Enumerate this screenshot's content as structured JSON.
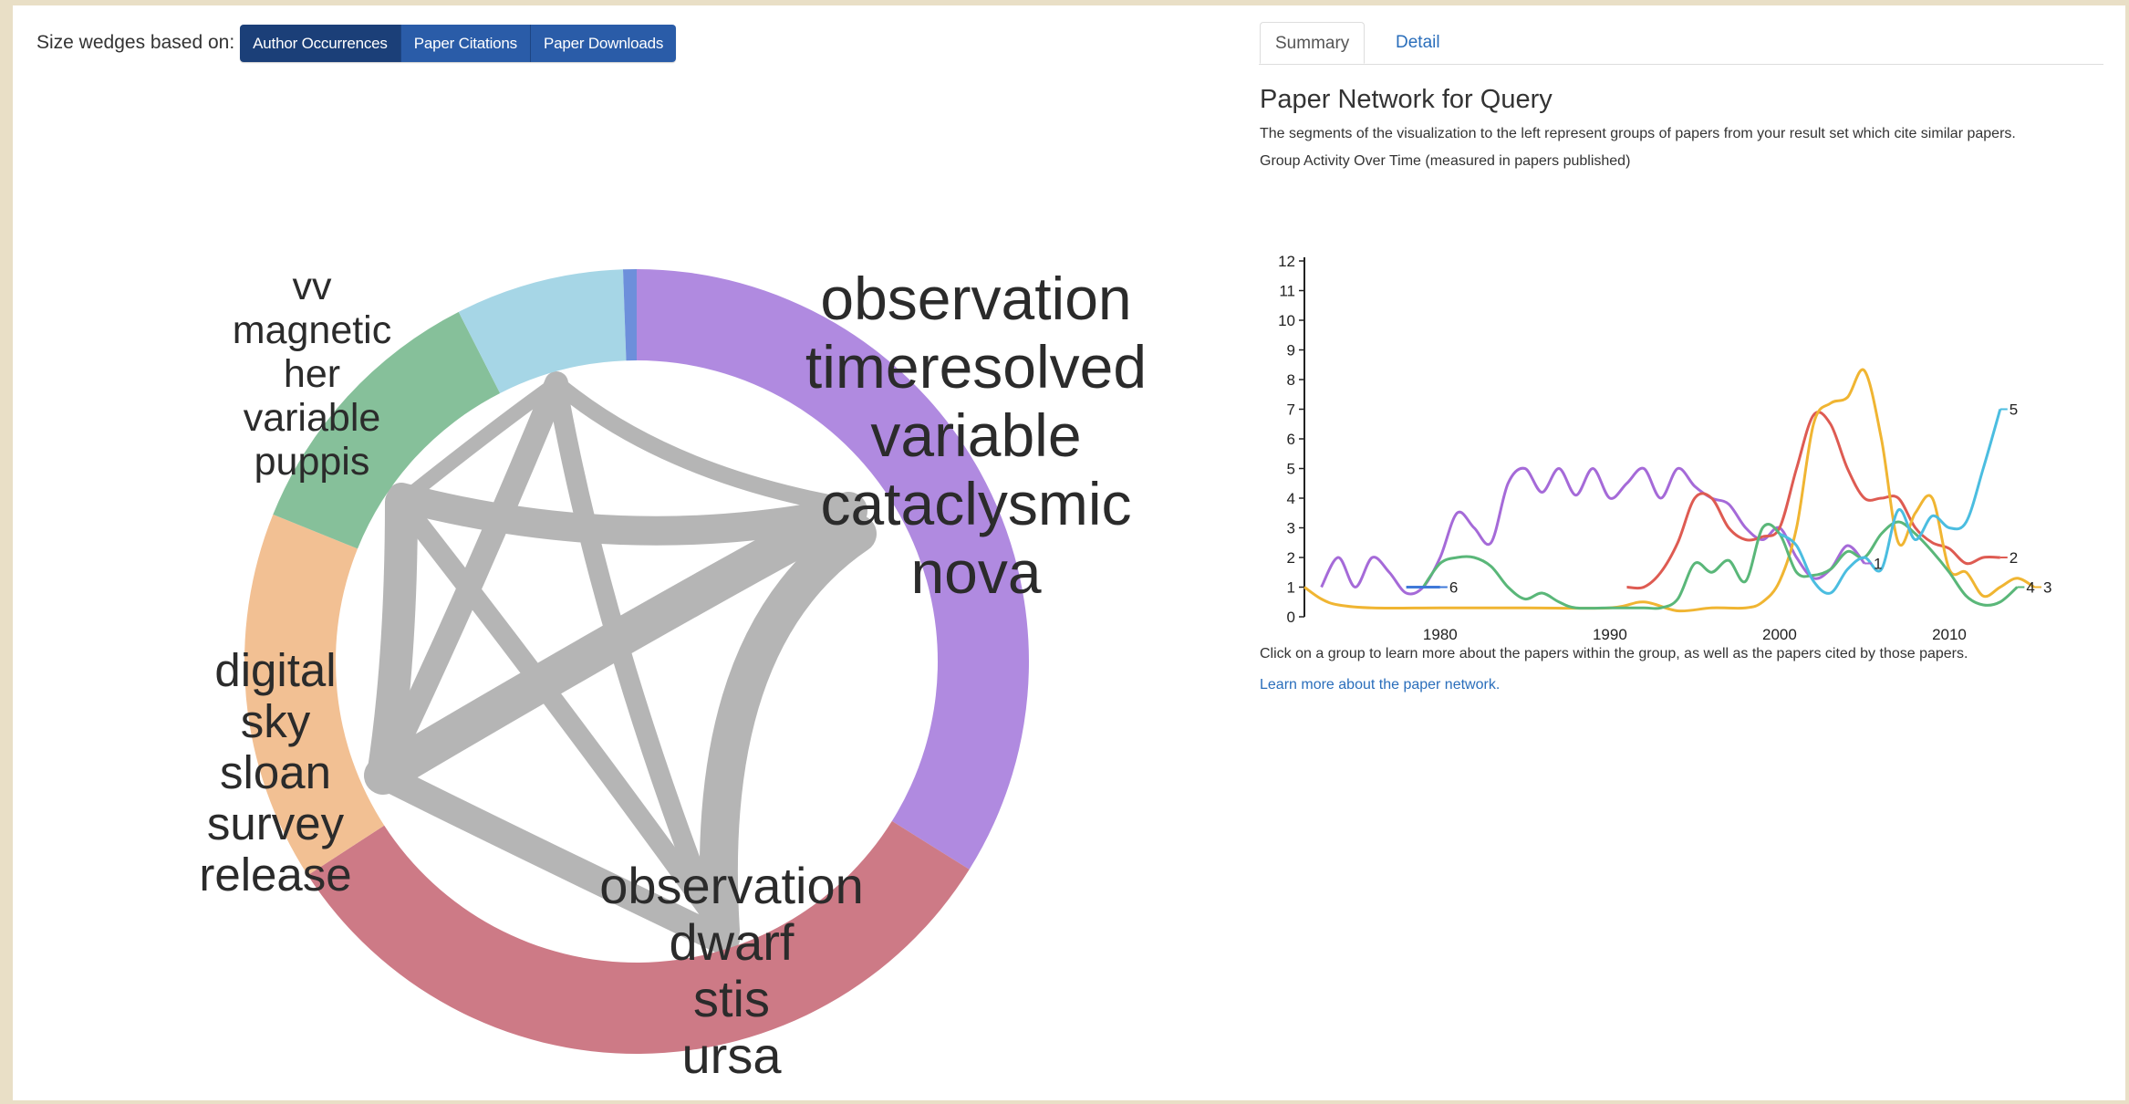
{
  "toolbar": {
    "label": "Size wedges based on:",
    "buttons": [
      "Author Occurrences",
      "Paper Citations",
      "Paper Downloads"
    ]
  },
  "wheel": {
    "groups": [
      {
        "name": "purple",
        "color": "#b08ae0",
        "lines": [
          "observation",
          "timeresolved",
          "variable",
          "cataclysmic",
          "nova"
        ]
      },
      {
        "name": "red",
        "color": "#cd7a86",
        "lines": [
          "observation",
          "dwarf",
          "stis",
          "ursa"
        ]
      },
      {
        "name": "orange",
        "color": "#f2c093",
        "lines": [
          "digital",
          "sky",
          "sloan",
          "survey",
          "release"
        ]
      },
      {
        "name": "green",
        "color": "#86c09a",
        "lines": [
          "vv",
          "magnetic",
          "her",
          "variable",
          "puppis"
        ]
      },
      {
        "name": "lightblue",
        "color": "#a6d6e6",
        "lines": []
      },
      {
        "name": "blue",
        "color": "#6d8fdb",
        "lines": []
      }
    ],
    "link_color": "#7a7a7a"
  },
  "panel": {
    "tabs": [
      "Summary",
      "Detail"
    ],
    "title": "Paper Network for Query",
    "description": "The segments of the visualization to the left represent groups of papers from your result set which cite similar papers.",
    "chart_title": "Group Activity Over Time (measured in papers published)",
    "click_info": "Click on a group to learn more about the papers within the group, as well as the papers cited by those papers.",
    "learn_more": "Learn more about the paper network."
  },
  "chart_data": {
    "type": "line",
    "title": "Group Activity Over Time (measured in papers published)",
    "xlabel": "",
    "ylabel": "",
    "xlim": [
      1972,
      2015
    ],
    "ylim": [
      0,
      12
    ],
    "x_ticks": [
      1980,
      1990,
      2000,
      2010
    ],
    "y_ticks": [
      0,
      1,
      2,
      3,
      4,
      5,
      6,
      7,
      8,
      9,
      10,
      11,
      12
    ],
    "series": [
      {
        "name": "1",
        "color": "#a56ad8",
        "x": [
          1973,
          1974,
          1975,
          1976,
          1977,
          1978,
          1979,
          1980,
          1981,
          1982,
          1983,
          1984,
          1985,
          1986,
          1987,
          1988,
          1989,
          1990,
          1991,
          1992,
          1993,
          1994,
          1995,
          1996,
          1997,
          1998,
          1999,
          2000,
          2001,
          2002,
          2003,
          2004,
          2005
        ],
        "y": [
          1,
          2,
          1,
          2,
          1.5,
          0.8,
          1,
          2,
          3.5,
          3,
          2.5,
          4.5,
          5,
          4.2,
          5,
          4.1,
          5,
          4,
          4.5,
          5,
          4,
          5,
          4.4,
          4,
          3.8,
          3,
          2.6,
          3,
          2,
          1.3,
          1.6,
          2.4,
          1.8
        ]
      },
      {
        "name": "2",
        "color": "#de5b52",
        "x": [
          1991,
          1992,
          1993,
          1994,
          1995,
          1996,
          1997,
          1998,
          1999,
          2000,
          2001,
          2002,
          2003,
          2004,
          2005,
          2006,
          2007,
          2008,
          2009,
          2010,
          2011,
          2012,
          2013
        ],
        "y": [
          1,
          1,
          1.5,
          2.5,
          4,
          4,
          3,
          2.6,
          2.7,
          3,
          5,
          6.8,
          6.5,
          5,
          4,
          4,
          4,
          3,
          2.5,
          2.3,
          1.8,
          2,
          2
        ]
      },
      {
        "name": "3",
        "color": "#f0b532",
        "x": [
          1972,
          1973,
          1974,
          1976,
          1980,
          1985,
          1990,
          1992,
          1994,
          1996,
          1998,
          1999,
          2000,
          2001,
          2002,
          2003,
          2004,
          2005,
          2006,
          2007,
          2008,
          2009,
          2010,
          2011,
          2012,
          2013,
          2014,
          2015
        ],
        "y": [
          1,
          0.6,
          0.4,
          0.3,
          0.3,
          0.3,
          0.3,
          0.5,
          0.2,
          0.3,
          0.3,
          0.5,
          1.2,
          3,
          6.5,
          7.2,
          7.4,
          8.3,
          6,
          2.5,
          3.5,
          4,
          1.6,
          1.5,
          0.7,
          1,
          1.3,
          1
        ]
      },
      {
        "name": "4",
        "color": "#5ab779",
        "x": [
          1979,
          1980,
          1981,
          1982,
          1983,
          1984,
          1985,
          1986,
          1987,
          1988,
          1990,
          1992,
          1993,
          1994,
          1995,
          1996,
          1997,
          1998,
          1999,
          2000,
          2001,
          2002,
          2003,
          2004,
          2005,
          2006,
          2007,
          2008,
          2009,
          2010,
          2011,
          2012,
          2013,
          2014
        ],
        "y": [
          1,
          1.8,
          2,
          2,
          1.7,
          1,
          0.6,
          0.8,
          0.5,
          0.3,
          0.3,
          0.3,
          0.3,
          0.6,
          1.8,
          1.5,
          1.9,
          1.2,
          3,
          2.8,
          1.5,
          1.4,
          1.6,
          2.2,
          2,
          2.8,
          3.2,
          2.8,
          2.2,
          1.5,
          0.7,
          0.4,
          0.5,
          1
        ]
      },
      {
        "name": "5",
        "color": "#4bbde0",
        "x": [
          2000,
          2001,
          2002,
          2003,
          2004,
          2005,
          2006,
          2007,
          2008,
          2009,
          2010,
          2011,
          2012,
          2013
        ],
        "y": [
          2.8,
          2.4,
          1.2,
          0.8,
          1.6,
          2,
          1.6,
          3.6,
          2.6,
          3.4,
          3,
          3.2,
          5,
          7
        ]
      },
      {
        "name": "6",
        "color": "#3f79d8",
        "x": [
          1978,
          1979,
          1980
        ],
        "y": [
          1,
          1,
          1
        ]
      }
    ]
  }
}
